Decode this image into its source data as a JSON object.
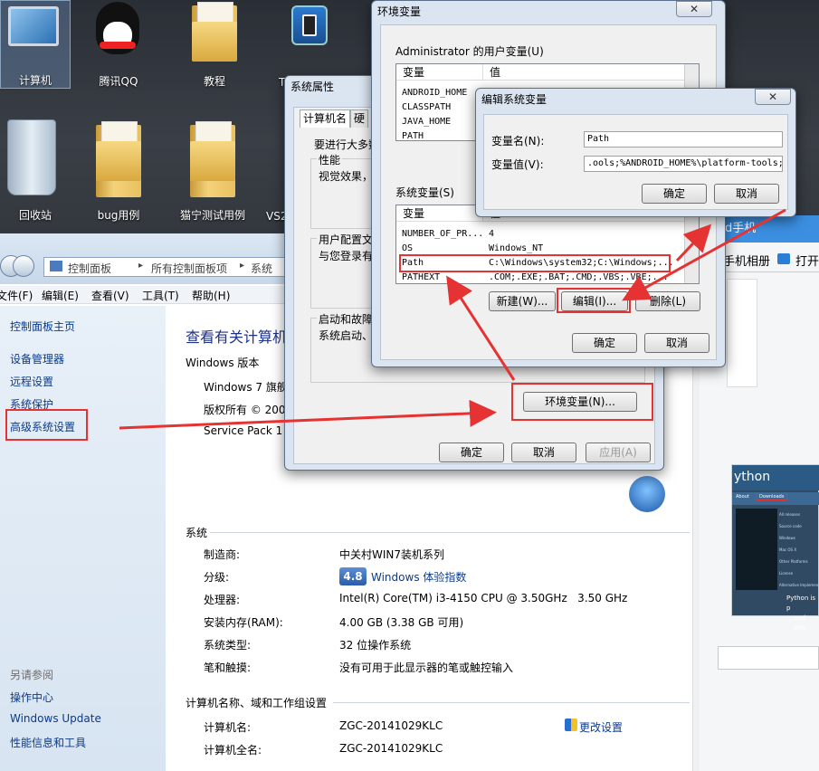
{
  "desktop": {
    "icons": [
      {
        "label": "计算机",
        "name": "computer"
      },
      {
        "label": "腾讯QQ",
        "name": "qq"
      },
      {
        "label": "教程",
        "name": "folder"
      },
      {
        "label": "T",
        "name": "app"
      },
      {
        "label": "回收站",
        "name": "recycle-bin"
      },
      {
        "label": "bug用例",
        "name": "folder"
      },
      {
        "label": "猫宁测试用例",
        "name": "folder"
      },
      {
        "label": "VS2",
        "name": "app"
      }
    ]
  },
  "control_panel": {
    "breadcrumb": [
      "控制面板",
      "所有控制面板项",
      "系统"
    ],
    "menu": [
      "文件(F)",
      "编辑(E)",
      "查看(V)",
      "工具(T)",
      "帮助(H)"
    ],
    "sidebar": {
      "home": "控制面板主页",
      "links": [
        "设备管理器",
        "远程设置",
        "系统保护",
        "高级系统设置"
      ],
      "see_also_title": "另请参阅",
      "see_also": [
        "操作中心",
        "Windows Update",
        "性能信息和工具"
      ]
    },
    "heading": "查看有关计算机",
    "edition_title": "Windows 版本",
    "edition_lines": [
      "Windows 7 旗舰",
      "版权所有 © 200",
      "Service Pack 1"
    ],
    "system_title": "系统",
    "system": [
      {
        "label": "制造商:",
        "value": "中关村WIN7装机系列"
      },
      {
        "label": "分级:",
        "value": "Windows 体验指数"
      },
      {
        "label": "处理器:",
        "value": "Intel(R) Core(TM) i3-4150 CPU @ 3.50GHz   3.50 GHz"
      },
      {
        "label": "安装内存(RAM):",
        "value": "4.00 GB (3.38 GB 可用)"
      },
      {
        "label": "系统类型:",
        "value": "32 位操作系统"
      },
      {
        "label": "笔和触摸:",
        "value": "没有可用于此显示器的笔或触控输入"
      }
    ],
    "rating": "4.8",
    "computer_title": "计算机名称、域和工作组设置",
    "computer": [
      {
        "label": "计算机名:",
        "value": "ZGC-20141029KLC"
      },
      {
        "label": "计算机全名:",
        "value": "ZGC-20141029KLC"
      }
    ],
    "change_settings": "更改设置"
  },
  "sys_props": {
    "title": "系统属性",
    "tabs": [
      "计算机名",
      "硬"
    ],
    "intro": "要进行大多数",
    "perf_title": "性能",
    "perf_text": "视觉效果，",
    "profile_title": "用户配置文",
    "profile_text": "与您登录有",
    "startup_title": "启动和故障",
    "startup_text": "系统启动、",
    "env_button": "环境变量(N)...",
    "ok": "确定",
    "cancel": "取消",
    "apply": "应用(A)"
  },
  "env_vars": {
    "title": "环境变量",
    "user_group": "Administrator 的用户变量(U)",
    "col_var": "变量",
    "col_val": "值",
    "user_vars": [
      "ANDROID_HOME",
      "CLASSPATH",
      "JAVA_HOME",
      "PATH"
    ],
    "sys_group": "系统变量(S)",
    "sys_vars": [
      {
        "name": "NUMBER_OF_PR...",
        "value": "4"
      },
      {
        "name": "OS",
        "value": "Windows_NT"
      },
      {
        "name": "Path",
        "value": "C:\\Windows\\system32;C:\\Windows;..."
      },
      {
        "name": "PATHEXT",
        "value": ".COM;.EXE;.BAT;.CMD;.VBS;.VBE;..."
      }
    ],
    "new": "新建(W)...",
    "edit": "编辑(I)...",
    "delete": "删除(L)",
    "ok": "确定",
    "cancel": "取消"
  },
  "edit_var": {
    "title": "编辑系统变量",
    "name_label": "变量名(N):",
    "name_value": "Path",
    "value_label": "变量值(V):",
    "value_value": ".ools;%ANDROID_HOME%\\platform-tools;",
    "ok": "确定",
    "cancel": "取消"
  },
  "right_window": {
    "title": "d手机",
    "album": "手机相册",
    "open": "打开",
    "python_logo": "ython",
    "python_nav": [
      "About",
      "Downloads"
    ],
    "python_menu": [
      "All releases",
      "Source code",
      "Windows",
      "Mac OS X",
      "Other Platforms",
      "License",
      "Alternative Implemen"
    ],
    "python_footer": [
      "Python is p",
      "and inte"
    ]
  },
  "close_glyph": "✕",
  "colors": {
    "highlight": "#e53333",
    "link": "#0b3b8c"
  }
}
